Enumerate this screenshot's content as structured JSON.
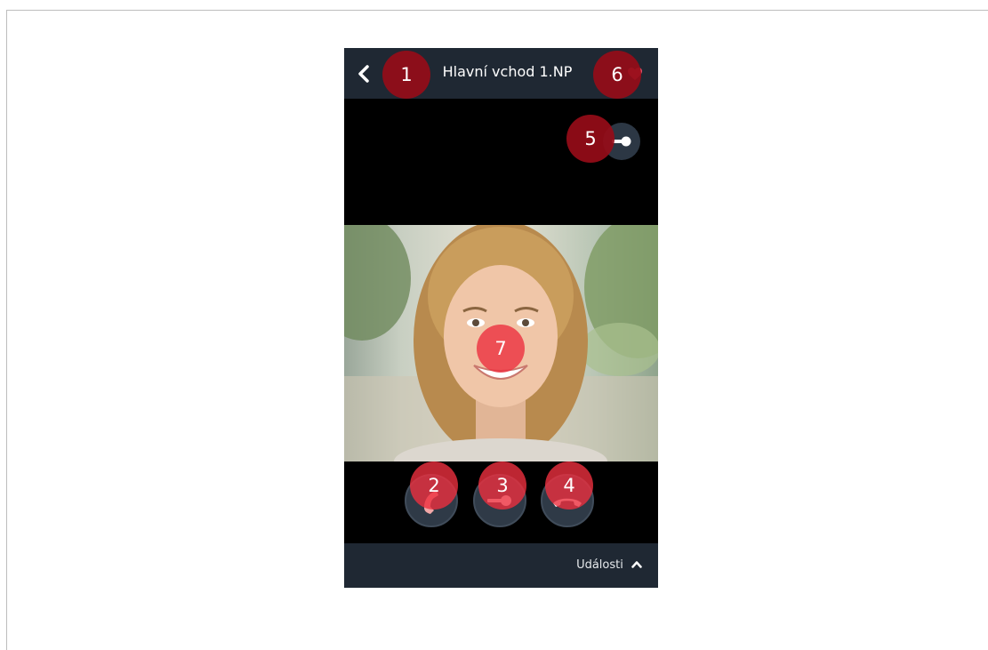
{
  "header": {
    "title": "Hlavní vchod 1.NP",
    "back_icon": "chevron-left-icon",
    "favorite_icon": "heart-icon"
  },
  "actions": {
    "unlock_top_icon": "key-icon",
    "answer_icon": "phone-answer-icon",
    "unlock_icon": "key-icon",
    "hangup_icon": "phone-hangup-icon"
  },
  "footer": {
    "events_label": "Události",
    "events_icon": "chevron-up-icon"
  },
  "markers": {
    "m1": "1",
    "m2": "2",
    "m3": "3",
    "m4": "4",
    "m5": "5",
    "m6": "6",
    "m7": "7"
  },
  "colors": {
    "bar_bg": "#1f2833",
    "button_bg": "#2f3a47",
    "marker_dark": "#960c18",
    "marker_light": "#ec303e",
    "answer_accent": "#f08080"
  }
}
